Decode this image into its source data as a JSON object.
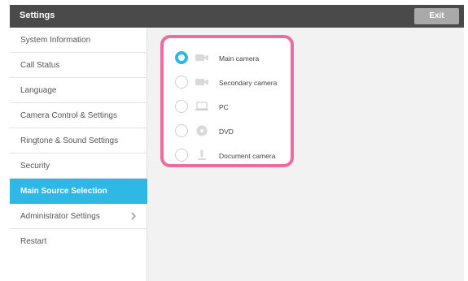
{
  "window": {
    "title": "Settings",
    "exit_label": "Exit"
  },
  "sidebar": {
    "items": [
      {
        "label": "System Information"
      },
      {
        "label": "Call Status"
      },
      {
        "label": "Language"
      },
      {
        "label": "Camera Control & Settings"
      },
      {
        "label": "Ringtone & Sound Settings"
      },
      {
        "label": "Security"
      },
      {
        "label": "Main Source Selection",
        "active": true
      },
      {
        "label": "Administrator Settings",
        "has_submenu": true
      },
      {
        "label": "Restart"
      }
    ]
  },
  "source_selection": {
    "options": [
      {
        "label": "Main camera",
        "icon": "camera-icon",
        "selected": true
      },
      {
        "label": "Secondary camera",
        "icon": "camera-icon",
        "selected": false
      },
      {
        "label": "PC",
        "icon": "laptop-icon",
        "selected": false
      },
      {
        "label": "DVD",
        "icon": "disc-icon",
        "selected": false
      },
      {
        "label": "Document camera",
        "icon": "document-camera-icon",
        "selected": false
      }
    ]
  },
  "colors": {
    "accent": "#2fb7e6",
    "highlight_border": "#f06aa0",
    "titlebar": "#4a4a4a"
  }
}
